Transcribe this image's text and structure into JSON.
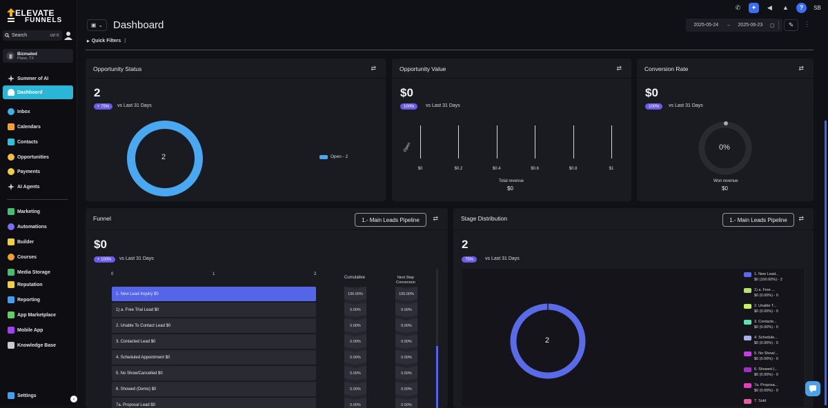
{
  "brand": {
    "line1": "ELEVATE",
    "line2": "FUNNELS"
  },
  "search": {
    "label": "Search",
    "shortcut": "ctrl K"
  },
  "account": {
    "name": "Bizmated",
    "location": "Plano, TX"
  },
  "sidebar": {
    "items": [
      {
        "label": "Summer of AI",
        "icon": "sparkle-icon",
        "color": "#c9c9d0"
      },
      {
        "label": "Dashboard",
        "icon": "dashboard-icon",
        "color": "#ffffff"
      },
      {
        "label": "Inbox",
        "icon": "inbox-icon",
        "color": "#3fb0e8"
      },
      {
        "label": "Calendars",
        "icon": "calendar-icon",
        "color": "#f0a030"
      },
      {
        "label": "Contacts",
        "icon": "contacts-icon",
        "color": "#2ec0d8"
      },
      {
        "label": "Opportunities",
        "icon": "opportunities-icon",
        "color": "#f0c040"
      },
      {
        "label": "Payments",
        "icon": "payments-icon",
        "color": "#f0d040"
      },
      {
        "label": "AI Agents",
        "icon": "ai-agents-icon",
        "color": "#c9c9d0"
      },
      {
        "label": "Marketing",
        "icon": "marketing-icon",
        "color": "#40c070"
      },
      {
        "label": "Automations",
        "icon": "automations-icon",
        "color": "#7a6ef0"
      },
      {
        "label": "Builder",
        "icon": "builder-icon",
        "color": "#f0d040"
      },
      {
        "label": "Courses",
        "icon": "courses-icon",
        "color": "#f0a030"
      },
      {
        "label": "Media Storage",
        "icon": "media-storage-icon",
        "color": "#40c070"
      },
      {
        "label": "Reputation",
        "icon": "reputation-icon",
        "color": "#f0d040"
      },
      {
        "label": "Reporting",
        "icon": "reporting-icon",
        "color": "#3fa0f0"
      },
      {
        "label": "App Marketplace",
        "icon": "app-marketplace-icon",
        "color": "#60d060"
      },
      {
        "label": "Mobile App",
        "icon": "mobile-app-icon",
        "color": "#a040f0"
      },
      {
        "label": "Knowledge Base",
        "icon": "knowledge-base-icon",
        "color": "#c9c9d0"
      },
      {
        "label": "Settings",
        "icon": "settings-icon",
        "color": "#3fa0f0"
      }
    ]
  },
  "topbar": {
    "user_initials": "SB",
    "help": "?"
  },
  "header": {
    "title": "Dashboard",
    "date_from": "2025-05-24",
    "date_arrow": "→",
    "date_to": "2025-06-23",
    "quick_filters": "Quick Filters"
  },
  "opportunity_status": {
    "title": "Opportunity Status",
    "value": "2",
    "badge": "+ 75%",
    "vs": "vs Last 31 Days",
    "center": "2",
    "legend": "Open - 2",
    "ring_color": "#4aa8f0"
  },
  "opportunity_value": {
    "title": "Opportunity Value",
    "value": "$0",
    "badge": "100%",
    "vs": "vs Last 31 Days",
    "y_label": "Open",
    "ticks": [
      "$0",
      "$0.2",
      "$0.4",
      "$0.6",
      "$0.8",
      "$1"
    ],
    "footer_label": "Total revenue",
    "footer_value": "$0"
  },
  "conversion_rate": {
    "title": "Conversion Rate",
    "value": "$0",
    "badge": "100%",
    "vs": "vs Last 31 Days",
    "center": "0%",
    "footer_label": "Won revenue",
    "footer_value": "$0"
  },
  "funnel": {
    "title": "Funnel",
    "pipeline": "1.- Main Leads Pipeline",
    "value": "$0",
    "badge": "+ 100%",
    "vs": "vs Last 31 Days",
    "axis": [
      "0",
      "1",
      "2"
    ],
    "col_cumulative": "Cumulative",
    "col_next_line1": "Next Step",
    "col_next_line2": "Conversion",
    "rows": [
      {
        "label": "1. New Lead Inquiry   $0",
        "cum": "100.00%",
        "next": "100.00%"
      },
      {
        "label": "1) a. Free Trial Lead   $0",
        "cum": "0.00%",
        "next": "0.00%"
      },
      {
        "label": "2. Unable To Contact Lead   $0",
        "cum": "0.00%",
        "next": "0.00%"
      },
      {
        "label": "3. Contacted Lead   $0",
        "cum": "0.00%",
        "next": "0.00%"
      },
      {
        "label": "4. Scheduled Appointment   $0",
        "cum": "0.00%",
        "next": "0.00%"
      },
      {
        "label": "5. No Show/Cancelled   $0",
        "cum": "0.00%",
        "next": "0.00%"
      },
      {
        "label": "6. Showed (Demo)   $0",
        "cum": "0.00%",
        "next": "0.00%"
      },
      {
        "label": "7a. Proposal Lead   $0",
        "cum": "0.00%",
        "next": "0.00%"
      }
    ]
  },
  "stage_distribution": {
    "title": "Stage Distribution",
    "pipeline": "1.- Main Leads Pipeline",
    "value": "2",
    "badge": "75%",
    "vs": "vs Last 31 Days",
    "center": "2",
    "ring_color": "#5a6be8",
    "legend": [
      {
        "l1": "1. New Lead...",
        "l2": "$0 (100.00%) - 2",
        "color": "#5a6be8"
      },
      {
        "l1": "1) a. Free ...",
        "l2": "$0 (0.00%) - 0",
        "color": "#b8e070"
      },
      {
        "l1": "2. Unable T...",
        "l2": "$0 (0.00%) - 0",
        "color": "#c8f060"
      },
      {
        "l1": "3. Contacte...",
        "l2": "$0 (0.00%) - 0",
        "color": "#60e0b0"
      },
      {
        "l1": "4. Schedule...",
        "l2": "$0 (0.00%) - 0",
        "color": "#a8b0e8"
      },
      {
        "l1": "5. No Show/...",
        "l2": "$0 (0.00%) - 0",
        "color": "#c040e0"
      },
      {
        "l1": "6. Showed (...",
        "l2": "$0 (0.00%) - 0",
        "color": "#a030c0"
      },
      {
        "l1": "7a. Proposa...",
        "l2": "$0 (0.00%) - 0",
        "color": "#e040c0"
      },
      {
        "l1": "7. Sold",
        "l2": "",
        "color": "#e060a0"
      }
    ]
  }
}
